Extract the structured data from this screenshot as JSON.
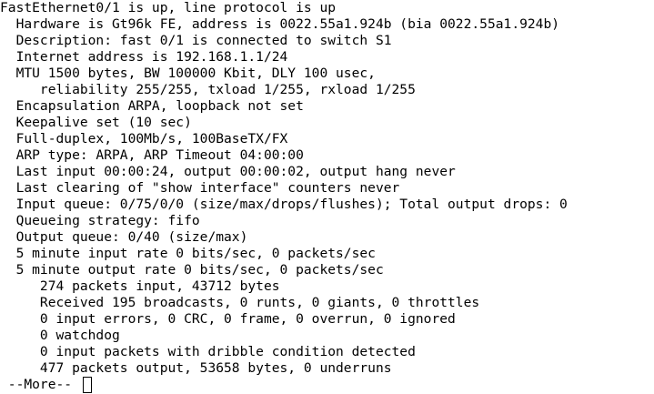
{
  "terminal": {
    "lines": [
      "FastEthernet0/1 is up, line protocol is up",
      "  Hardware is Gt96k FE, address is 0022.55a1.924b (bia 0022.55a1.924b)",
      "  Description: fast 0/1 is connected to switch S1",
      "  Internet address is 192.168.1.1/24",
      "  MTU 1500 bytes, BW 100000 Kbit, DLY 100 usec,",
      "     reliability 255/255, txload 1/255, rxload 1/255",
      "  Encapsulation ARPA, loopback not set",
      "  Keepalive set (10 sec)",
      "  Full-duplex, 100Mb/s, 100BaseTX/FX",
      "  ARP type: ARPA, ARP Timeout 04:00:00",
      "  Last input 00:00:24, output 00:00:02, output hang never",
      "  Last clearing of \"show interface\" counters never",
      "  Input queue: 0/75/0/0 (size/max/drops/flushes); Total output drops: 0",
      "  Queueing strategy: fifo",
      "  Output queue: 0/40 (size/max)",
      "  5 minute input rate 0 bits/sec, 0 packets/sec",
      "  5 minute output rate 0 bits/sec, 0 packets/sec",
      "     274 packets input, 43712 bytes",
      "     Received 195 broadcasts, 0 runts, 0 giants, 0 throttles",
      "     0 input errors, 0 CRC, 0 frame, 0 overrun, 0 ignored",
      "     0 watchdog",
      "     0 input packets with dribble condition detected",
      "     477 packets output, 53658 bytes, 0 underruns"
    ],
    "more_prompt": " --More-- "
  }
}
